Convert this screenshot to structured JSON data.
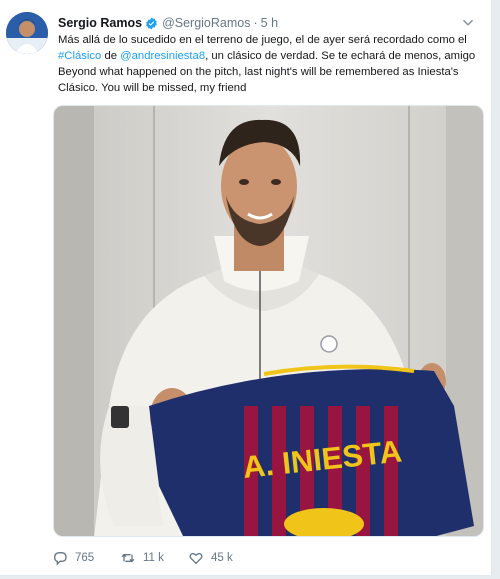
{
  "tweet": {
    "display_name": "Sergio Ramos",
    "handle": "@SergioRamos",
    "separator": "·",
    "time": "5 h",
    "text": {
      "line1": "Más allá de lo sucedido en el terreno de juego, el de ayer será recordado como el",
      "line2_link1": "#Clásico",
      "line2_mid": " de ",
      "line2_link2": "@andresiniesta8",
      "line2_tail": ", un clásico de verdad. Se te echará de menos, amigo",
      "line3": "Beyond what happened on the pitch, last night's will be remembered as Iniesta's",
      "line4": "Clásico. You will be missed, my friend"
    },
    "photo": {
      "shirt_name": "A. INIESTA"
    },
    "actions": {
      "reply_count": "765",
      "retweet_count": "11 k",
      "like_count": "45 k"
    }
  },
  "colors": {
    "link": "#1da1f2",
    "verified": "#1da1f2",
    "muted": "#657786",
    "shirt_blue": "#1f2f6b",
    "shirt_red": "#a4133c",
    "shirt_gold": "#f0c419"
  }
}
